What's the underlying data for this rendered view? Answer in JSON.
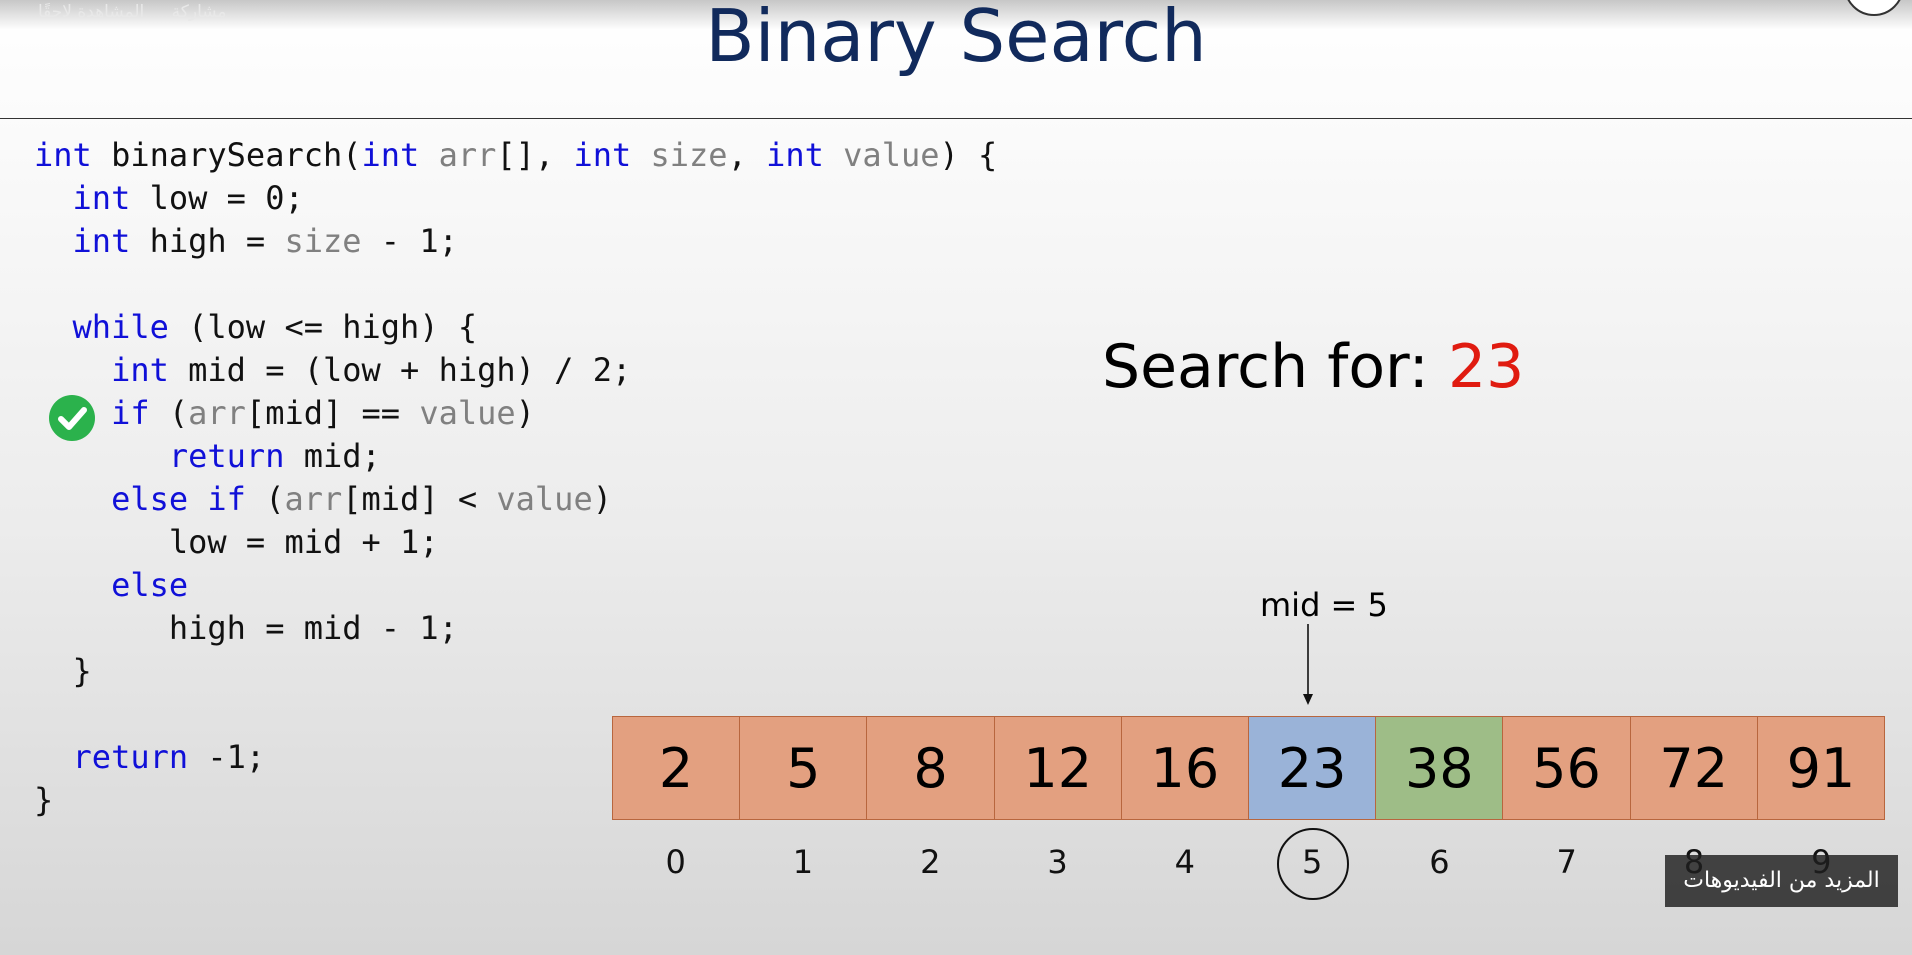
{
  "youtube_overlay": {
    "share_label": "مشاركة",
    "watch_later_label": "المشاهدة لاحقًا",
    "more_videos_label": "المزيد من الفيديوهات"
  },
  "slide": {
    "title": "Binary Search",
    "code_lines": [
      [
        {
          "t": "int",
          "c": "kw"
        },
        {
          "t": " binarySearch(",
          "c": ""
        },
        {
          "t": "int",
          "c": "kw"
        },
        {
          "t": " ",
          "c": ""
        },
        {
          "t": "arr",
          "c": "pm"
        },
        {
          "t": "[], ",
          "c": ""
        },
        {
          "t": "int",
          "c": "kw"
        },
        {
          "t": " ",
          "c": ""
        },
        {
          "t": "size",
          "c": "pm"
        },
        {
          "t": ", ",
          "c": ""
        },
        {
          "t": "int",
          "c": "kw"
        },
        {
          "t": " ",
          "c": ""
        },
        {
          "t": "value",
          "c": "pm"
        },
        {
          "t": ") {",
          "c": ""
        }
      ],
      [
        {
          "t": "  ",
          "c": ""
        },
        {
          "t": "int",
          "c": "kw"
        },
        {
          "t": " low = 0;",
          "c": ""
        }
      ],
      [
        {
          "t": "  ",
          "c": ""
        },
        {
          "t": "int",
          "c": "kw"
        },
        {
          "t": " high = ",
          "c": ""
        },
        {
          "t": "size",
          "c": "pm"
        },
        {
          "t": " - 1;",
          "c": ""
        }
      ],
      [
        {
          "t": "",
          "c": ""
        }
      ],
      [
        {
          "t": "  ",
          "c": ""
        },
        {
          "t": "while",
          "c": "kw"
        },
        {
          "t": " (low <= high) {",
          "c": ""
        }
      ],
      [
        {
          "t": "    ",
          "c": ""
        },
        {
          "t": "int",
          "c": "kw"
        },
        {
          "t": " mid = (low + high) / 2;",
          "c": ""
        }
      ],
      [
        {
          "t": "    ",
          "c": ""
        },
        {
          "t": "if",
          "c": "kw"
        },
        {
          "t": " (",
          "c": ""
        },
        {
          "t": "arr",
          "c": "pm"
        },
        {
          "t": "[mid] == ",
          "c": ""
        },
        {
          "t": "value",
          "c": "pm"
        },
        {
          "t": ")",
          "c": ""
        }
      ],
      [
        {
          "t": "       ",
          "c": ""
        },
        {
          "t": "return",
          "c": "kw"
        },
        {
          "t": " mid;",
          "c": ""
        }
      ],
      [
        {
          "t": "    ",
          "c": ""
        },
        {
          "t": "else if",
          "c": "kw"
        },
        {
          "t": " (",
          "c": ""
        },
        {
          "t": "arr",
          "c": "pm"
        },
        {
          "t": "[mid] < ",
          "c": ""
        },
        {
          "t": "value",
          "c": "pm"
        },
        {
          "t": ")",
          "c": ""
        }
      ],
      [
        {
          "t": "       low = mid + 1;",
          "c": ""
        }
      ],
      [
        {
          "t": "    ",
          "c": ""
        },
        {
          "t": "else",
          "c": "kw"
        }
      ],
      [
        {
          "t": "       high = mid - 1;",
          "c": ""
        }
      ],
      [
        {
          "t": "  }",
          "c": ""
        }
      ],
      [
        {
          "t": "",
          "c": ""
        }
      ],
      [
        {
          "t": "  ",
          "c": ""
        },
        {
          "t": "return",
          "c": "kw"
        },
        {
          "t": " -1;",
          "c": ""
        }
      ],
      [
        {
          "t": "}",
          "c": ""
        }
      ]
    ],
    "search_prefix": "Search for: ",
    "search_value": "23",
    "mid_label": "mid = 5",
    "array": [
      {
        "value": "2",
        "index": "0",
        "state": "default"
      },
      {
        "value": "5",
        "index": "1",
        "state": "default"
      },
      {
        "value": "8",
        "index": "2",
        "state": "default"
      },
      {
        "value": "12",
        "index": "3",
        "state": "default"
      },
      {
        "value": "16",
        "index": "4",
        "state": "default"
      },
      {
        "value": "23",
        "index": "5",
        "state": "mid"
      },
      {
        "value": "38",
        "index": "6",
        "state": "right"
      },
      {
        "value": "56",
        "index": "7",
        "state": "default"
      },
      {
        "value": "72",
        "index": "8",
        "state": "default"
      },
      {
        "value": "91",
        "index": "9",
        "state": "default"
      }
    ],
    "colors": {
      "title": "#112a5c",
      "keyword": "#1010d8",
      "param": "#808080",
      "search_value": "#e01b10",
      "cell_default": "#e3a080",
      "cell_mid": "#9ab3d8",
      "cell_right": "#9ebd87",
      "check": "#2bb24c"
    },
    "icons": {
      "check": "check-circle-icon",
      "arrow": "arrow-down-icon"
    }
  }
}
